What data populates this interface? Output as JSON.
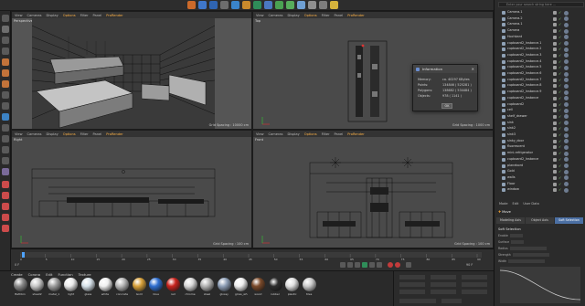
{
  "viewports": {
    "perspective": {
      "label": "Perspective",
      "menu": [
        "View",
        "Cameras",
        "Display",
        "Options",
        "Filter",
        "Panel",
        "ProRender"
      ],
      "grid_spacing": "Grid Spacing : 10000 cm"
    },
    "top": {
      "label": "Top",
      "menu": [
        "View",
        "Cameras",
        "Display",
        "Options",
        "Filter",
        "Panel",
        "ProRender"
      ],
      "grid_spacing": "Grid Spacing : 1000 cm"
    },
    "right": {
      "label": "Right",
      "menu": [
        "View",
        "Cameras",
        "Display",
        "Options",
        "Filter",
        "Panel",
        "ProRender"
      ],
      "grid_spacing": "Grid Spacing : 100 cm"
    },
    "front": {
      "label": "Front",
      "menu": [
        "View",
        "Cameras",
        "Display",
        "Options",
        "Filter",
        "Panel",
        "ProRender"
      ],
      "grid_spacing": "Grid Spacing : 100 cm"
    }
  },
  "info_dialog": {
    "title": "Information",
    "rows": [
      {
        "label": "Memory:",
        "value": "ca. 40297 KBytes"
      },
      {
        "label": "Points:",
        "value": "134846 ( 525281 )"
      },
      {
        "label": "Polygons:",
        "value": "138682 ( 534484 )"
      },
      {
        "label": "Objects:",
        "value": "978 ( 1141 )"
      }
    ],
    "ok_label": "OK"
  },
  "object_manager": {
    "search_placeholder": "Enter your search string here ...",
    "objects": [
      "Camera.1",
      "Camera.2",
      "Camera.1",
      "Camera",
      "Hochkant",
      "cupboard2_Instance.1",
      "cupboard2_Instance.2",
      "cupboard2_Instance.3",
      "cupboard2_Instance.4",
      "cupboard2_Instance.5",
      "cupboard2_Instance.6",
      "cupboard2_Instance.7",
      "cupboard2_Instance.8",
      "cupboard2_Instance.9",
      "cupboard2_Instance",
      "cupboard2",
      "cell",
      "shelf_drawer",
      "sink",
      "sink2",
      "sink3",
      "sinky_door",
      "fluorescent",
      "mini-refrigerator",
      "cupboard2_Instance",
      "planebord",
      "Gold",
      "walls",
      "Floor",
      "window"
    ]
  },
  "attributes": {
    "tabs": [
      "Mode",
      "Edit",
      "User Data"
    ],
    "move_label": "Move",
    "modes": [
      "Modeling Axis",
      "Object Axis",
      "Soft Selection"
    ],
    "section": "Soft Selection",
    "rows": [
      "Enable",
      "Surface",
      "Radius",
      "Strength",
      "Width"
    ]
  },
  "material_manager": {
    "menu": [
      "Create",
      "Corona",
      "Edit",
      "Function",
      "Texture"
    ],
    "materials": [
      {
        "name": "Bathbin",
        "color": "#8c8c8c"
      },
      {
        "name": "sheet2",
        "color": "#c9c9c9"
      },
      {
        "name": "metal_1",
        "color": "#a0a0a0"
      },
      {
        "name": "light",
        "color": "#ebebeb"
      },
      {
        "name": "glass",
        "color": "#d7e2ea"
      },
      {
        "name": "white",
        "color": "#f0f0f0"
      },
      {
        "name": "concrete",
        "color": "#b8b8b8"
      },
      {
        "name": "Gold",
        "color": "#d8a13a"
      },
      {
        "name": "blue",
        "color": "#2f6fd1"
      },
      {
        "name": "red",
        "color": "#c9231d"
      },
      {
        "name": "chrome",
        "color": "#d9d9d9"
      },
      {
        "name": "steel",
        "color": "#b5b5b5"
      },
      {
        "name": "glossy",
        "color": "#8fa0b8"
      },
      {
        "name": "gloss_wh",
        "color": "#eeeeee"
      },
      {
        "name": "wood",
        "color": "#7b4a2a"
      },
      {
        "name": "rubber",
        "color": "#2e2e2e"
      },
      {
        "name": "plastic",
        "color": "#e0e0e0"
      },
      {
        "name": "tiles",
        "color": "#cccccc"
      }
    ]
  },
  "timeline": {
    "frames": [
      "0",
      "5",
      "10",
      "15",
      "20",
      "25",
      "30",
      "35",
      "40",
      "45",
      "50",
      "55",
      "60",
      "65",
      "70",
      "75",
      "80",
      "85",
      "90"
    ],
    "start": "0 F",
    "end": "90 F"
  },
  "accent_color": "#f0a030"
}
